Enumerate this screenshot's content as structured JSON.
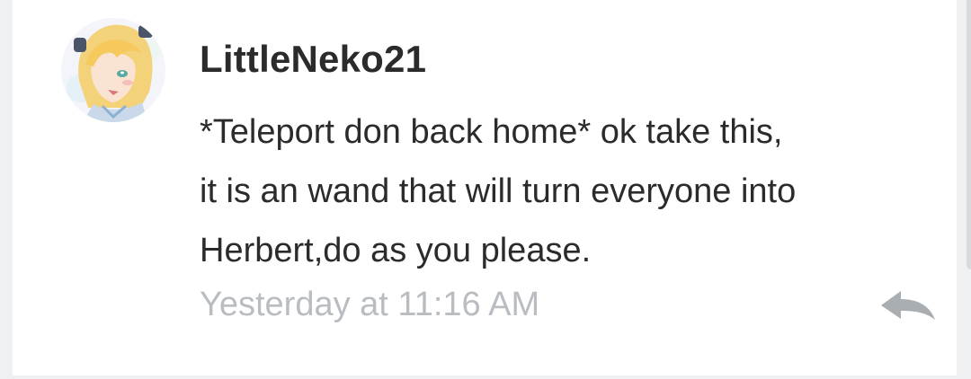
{
  "comment": {
    "username": "LittleNeko21",
    "message_lines": [
      "*Teleport don back home* ok take this,",
      "it is an wand that will turn everyone into",
      "Herbert,do as you please."
    ],
    "timestamp": "Yesterday at 11:16 AM",
    "avatar_icon": "anime-avatar",
    "reply_icon": "reply-arrow-icon"
  },
  "colors": {
    "card_background": "#ffffff",
    "page_background": "#eef0f1",
    "text": "#2b2b2b",
    "timestamp": "#b9bdc1",
    "reply_icon": "#a9aeb2"
  }
}
